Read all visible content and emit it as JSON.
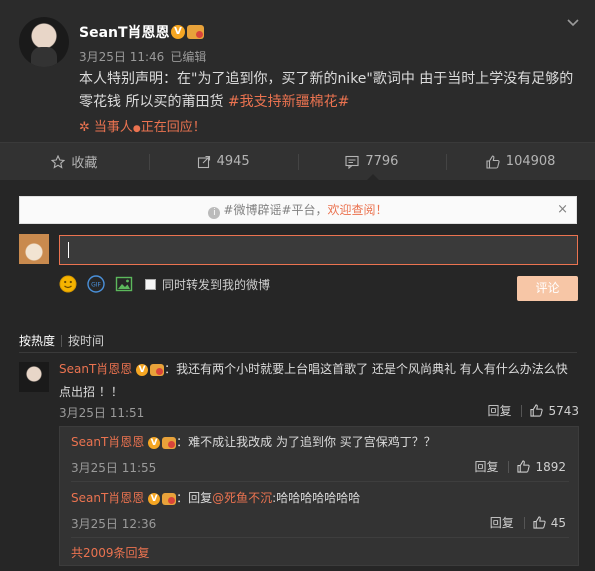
{
  "post": {
    "username": "SeanT肖恩恩",
    "verified_badge": "V",
    "date": "3月25日 11:46",
    "edited": "已编辑",
    "text_main": "本人特别声明：在\"为了追到你，买了新的nike\"歌词中 由于当时上学没有足够的零花钱 所以买的莆田货 ",
    "hashtag": "#我支持新疆棉花#",
    "live_label": "当事人",
    "live_suffix": "正在回应！"
  },
  "actions": {
    "favorite_label": "收藏",
    "share_count": "4945",
    "comment_count": "7796",
    "like_count": "104908"
  },
  "notice": {
    "prefix": "#微博辟谣#平台，",
    "link": "欢迎查阅！",
    "close": "×"
  },
  "composer": {
    "forward_label": "同时转发到我的微博",
    "submit_label": "评论",
    "gif_label": "GIF"
  },
  "sort": {
    "by_hot": "按热度",
    "by_time": "按时间"
  },
  "comment": {
    "username": "SeanT肖恩恩",
    "text": "：我还有两个小时就要上台唱这首歌了 还是个风尚典礼 有人有什么办法么快点出招 ！！",
    "time": "3月25日 11:51",
    "reply_label": "回复",
    "likes": "5743"
  },
  "replies": [
    {
      "username": "SeanT肖恩恩",
      "text": "：难不成让我改成 为了追到你 买了宫保鸡丁？？",
      "time": "3月25日 11:55",
      "reply_label": "回复",
      "likes": "1892"
    },
    {
      "username": "SeanT肖恩恩",
      "reply_prefix": "：回复",
      "mention": "@死鱼不沉",
      "text": ":哈哈哈哈哈哈哈",
      "time": "3月25日 12:36",
      "reply_label": "回复",
      "likes": "45"
    }
  ],
  "more_replies": "共2009条回复",
  "colors": {
    "accent": "#eb7350",
    "background": "#2b2b2b",
    "comments_bg": "#262626"
  }
}
